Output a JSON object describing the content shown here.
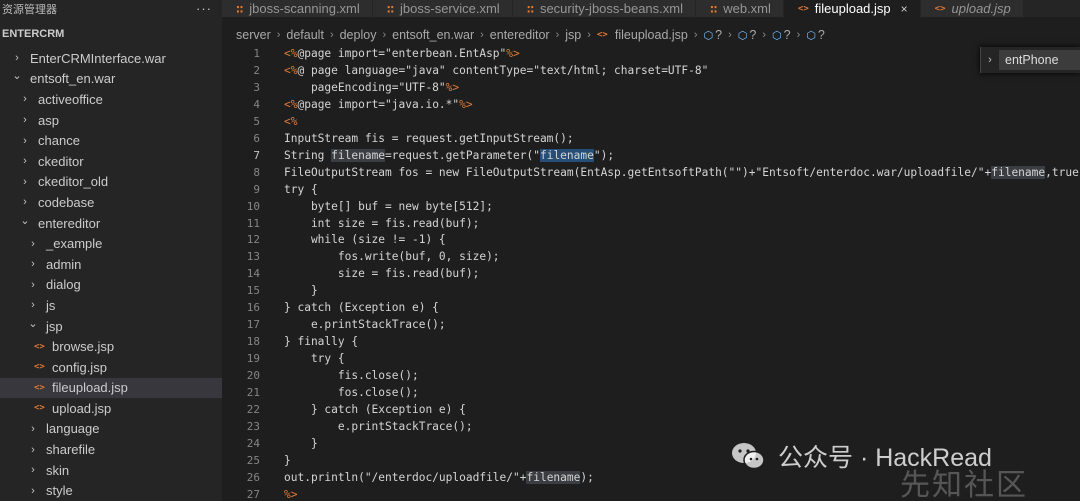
{
  "sidebar": {
    "title": "资源管理器",
    "more": "···",
    "section": "ENTERCRM",
    "items": [
      {
        "label": "EnterCRMInterface.war",
        "kind": "folder",
        "state": "collapsed",
        "depth": 1
      },
      {
        "label": "entsoft_en.war",
        "kind": "folder",
        "state": "expanded",
        "depth": 1
      },
      {
        "label": "activeoffice",
        "kind": "folder",
        "state": "collapsed",
        "depth": 2
      },
      {
        "label": "asp",
        "kind": "folder",
        "state": "collapsed",
        "depth": 2
      },
      {
        "label": "chance",
        "kind": "folder",
        "state": "collapsed",
        "depth": 2
      },
      {
        "label": "ckeditor",
        "kind": "folder",
        "state": "collapsed",
        "depth": 2
      },
      {
        "label": "ckeditor_old",
        "kind": "folder",
        "state": "collapsed",
        "depth": 2
      },
      {
        "label": "codebase",
        "kind": "folder",
        "state": "collapsed",
        "depth": 2
      },
      {
        "label": "entereditor",
        "kind": "folder",
        "state": "expanded",
        "depth": 2
      },
      {
        "label": "_example",
        "kind": "folder",
        "state": "collapsed",
        "depth": 3
      },
      {
        "label": "admin",
        "kind": "folder",
        "state": "collapsed",
        "depth": 3
      },
      {
        "label": "dialog",
        "kind": "folder",
        "state": "collapsed",
        "depth": 3
      },
      {
        "label": "js",
        "kind": "folder",
        "state": "collapsed",
        "depth": 3
      },
      {
        "label": "jsp",
        "kind": "folder",
        "state": "expanded",
        "depth": 3
      },
      {
        "label": "browse.jsp",
        "kind": "file",
        "depth": 4
      },
      {
        "label": "config.jsp",
        "kind": "file",
        "depth": 4
      },
      {
        "label": "fileupload.jsp",
        "kind": "file",
        "depth": 4,
        "selected": true
      },
      {
        "label": "upload.jsp",
        "kind": "file",
        "depth": 4
      },
      {
        "label": "language",
        "kind": "folder",
        "state": "collapsed",
        "depth": 3
      },
      {
        "label": "sharefile",
        "kind": "folder",
        "state": "collapsed",
        "depth": 3
      },
      {
        "label": "skin",
        "kind": "folder",
        "state": "collapsed",
        "depth": 3
      },
      {
        "label": "style",
        "kind": "folder",
        "state": "collapsed",
        "depth": 3
      }
    ]
  },
  "tabs": [
    {
      "label": "jboss-scanning.xml",
      "icon": "rss-icon"
    },
    {
      "label": "jboss-service.xml",
      "icon": "rss-icon"
    },
    {
      "label": "security-jboss-beans.xml",
      "icon": "rss-icon"
    },
    {
      "label": "web.xml",
      "icon": "rss-icon"
    },
    {
      "label": "fileupload.jsp",
      "icon": "code-icon",
      "active": true,
      "close": "×"
    },
    {
      "label": "upload.jsp",
      "icon": "code-icon",
      "italic": true
    }
  ],
  "breadcrumb": {
    "parts": [
      "server",
      "default",
      "deploy",
      "entsoft_en.war",
      "entereditor",
      "jsp",
      "fileupload.jsp"
    ],
    "symbols": [
      "?",
      "?",
      "?",
      "?"
    ]
  },
  "editor": {
    "lines": [
      {
        "n": "1",
        "segs": [
          [
            "tag",
            "<%"
          ],
          [
            "",
            "@page import=\"enterbean.EntAsp\""
          ],
          [
            "tag",
            "%>"
          ]
        ]
      },
      {
        "n": "2",
        "segs": [
          [
            "tag",
            "<%"
          ],
          [
            "",
            "@ page language=\"java\" contentType=\"text/html; charset=UTF-8\""
          ]
        ]
      },
      {
        "n": "3",
        "segs": [
          [
            "",
            "    pageEncoding=\"UTF-8\""
          ],
          [
            "tag",
            "%>"
          ]
        ]
      },
      {
        "n": "4",
        "segs": [
          [
            "tag",
            "<%"
          ],
          [
            "",
            "@page import=\"java.io.*\""
          ],
          [
            "tag",
            "%>"
          ]
        ]
      },
      {
        "n": "5",
        "segs": [
          [
            "tag",
            "<%"
          ]
        ]
      },
      {
        "n": "6",
        "segs": [
          [
            "",
            "InputStream fis = request.getInputStream();"
          ]
        ]
      },
      {
        "n": "7",
        "current": true,
        "segs": [
          [
            "",
            "String "
          ],
          [
            "hl2",
            "filename"
          ],
          [
            "",
            "=request.getParameter(\""
          ],
          [
            "hl",
            "filename"
          ],
          [
            "",
            "\");"
          ]
        ]
      },
      {
        "n": "8",
        "segs": [
          [
            "",
            "FileOutputStream fos = new FileOutputStream(EntAsp.getEntsoftPath(\"\")+\"Entsoft/enterdoc.war/uploadfile/\"+"
          ],
          [
            "hl2",
            "filename"
          ],
          [
            "",
            ",true"
          ]
        ]
      },
      {
        "n": "9",
        "segs": [
          [
            "",
            "try {"
          ]
        ]
      },
      {
        "n": "10",
        "segs": [
          [
            "",
            "    byte[] buf = new byte[512];"
          ]
        ]
      },
      {
        "n": "11",
        "segs": [
          [
            "",
            "    int size = fis.read(buf);"
          ]
        ]
      },
      {
        "n": "12",
        "segs": [
          [
            "",
            "    while (size != -1) {"
          ]
        ]
      },
      {
        "n": "13",
        "segs": [
          [
            "",
            "        fos.write(buf, 0, size);"
          ]
        ]
      },
      {
        "n": "14",
        "segs": [
          [
            "",
            "        size = fis.read(buf);"
          ]
        ]
      },
      {
        "n": "15",
        "segs": [
          [
            "",
            "    }"
          ]
        ]
      },
      {
        "n": "16",
        "segs": [
          [
            "",
            "} catch (Exception e) {"
          ]
        ]
      },
      {
        "n": "17",
        "segs": [
          [
            "",
            "    e.printStackTrace();"
          ]
        ]
      },
      {
        "n": "18",
        "segs": [
          [
            "",
            "} finally {"
          ]
        ]
      },
      {
        "n": "19",
        "segs": [
          [
            "",
            "    try {"
          ]
        ]
      },
      {
        "n": "20",
        "segs": [
          [
            "",
            "        fis.close();"
          ]
        ]
      },
      {
        "n": "21",
        "segs": [
          [
            "",
            "        fos.close();"
          ]
        ]
      },
      {
        "n": "22",
        "segs": [
          [
            "",
            "    } catch (Exception e) {"
          ]
        ]
      },
      {
        "n": "23",
        "segs": [
          [
            "",
            "        e.printStackTrace();"
          ]
        ]
      },
      {
        "n": "24",
        "segs": [
          [
            "",
            "    }"
          ]
        ]
      },
      {
        "n": "25",
        "segs": [
          [
            "",
            "}"
          ]
        ]
      },
      {
        "n": "26",
        "segs": [
          [
            "",
            "out.println(\"/enterdoc/uploadfile/\"+"
          ],
          [
            "hl2",
            "filename"
          ],
          [
            "",
            ");"
          ]
        ]
      },
      {
        "n": "27",
        "segs": [
          [
            "tag",
            "%>"
          ]
        ]
      }
    ]
  },
  "find": {
    "value": "entPhone",
    "chevron": "›"
  },
  "watermark": {
    "text": "公众号 · HackRead",
    "corner": "先知社区"
  },
  "colors": {
    "accent_orange": "#e37933",
    "selection": "#264f78",
    "symbol_blue": "#75beff"
  }
}
